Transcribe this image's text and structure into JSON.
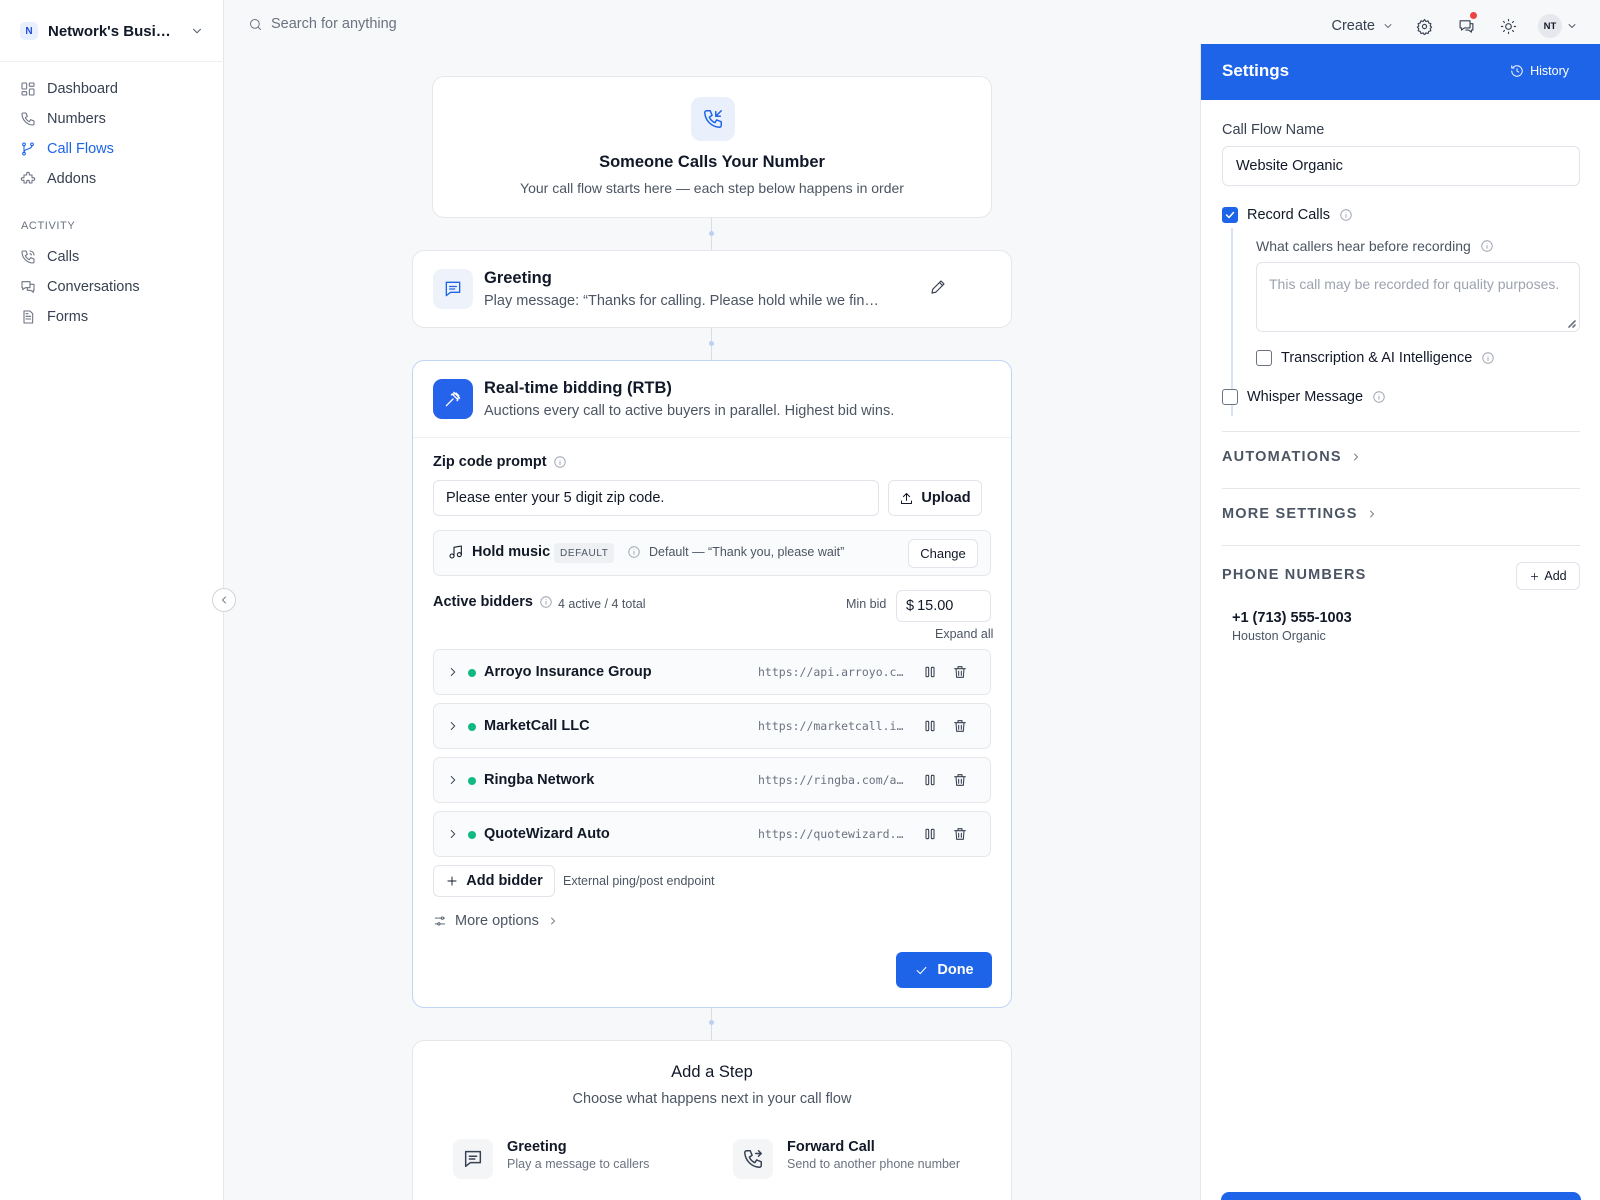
{
  "org": {
    "badge": "N",
    "name": "Network's Business"
  },
  "nav": {
    "items": [
      {
        "label": "Dashboard",
        "icon": "dashboard-icon"
      },
      {
        "label": "Numbers",
        "icon": "phone-icon"
      },
      {
        "label": "Call Flows",
        "icon": "call-flows-icon",
        "active": true
      },
      {
        "label": "Addons",
        "icon": "puzzle-icon"
      }
    ],
    "activity_heading": "ACTIVITY",
    "activity": [
      {
        "label": "Calls",
        "icon": "phone-calls-icon"
      },
      {
        "label": "Conversations",
        "icon": "chat-icon"
      },
      {
        "label": "Forms",
        "icon": "document-icon"
      }
    ]
  },
  "search": {
    "placeholder": "Search for anything"
  },
  "topbar": {
    "create_label": "Create",
    "avatar_initials": "NT",
    "has_notification": true
  },
  "flow": {
    "start": {
      "title": "Someone Calls Your Number",
      "subtitle": "Your call flow starts here — each step below happens in order"
    },
    "greeting": {
      "title": "Greeting",
      "subtitle": "Play message: “Thanks for calling. Please hold while we find the best agent for you.”"
    },
    "rtb": {
      "title": "Real-time bidding (RTB)",
      "subtitle": "Auctions every call to active buyers in parallel. Highest bid wins.",
      "zip_label": "Zip code prompt",
      "zip_value": "Please enter your 5 digit zip code.",
      "upload_label": "Upload",
      "hold_label": "Hold music",
      "hold_badge": "DEFAULT",
      "hold_desc": "Default — “Thank you, please wait”",
      "change_label": "Change",
      "bidders_label": "Active bidders",
      "bidders_count": "4 active / 4 total",
      "min_bid_label": "Min bid",
      "currency": "$",
      "min_bid_value": "15.00",
      "expand_all": "Expand all",
      "bidders": [
        {
          "name": "Arroyo Insurance Group",
          "url": "https://api.arroyo.com/rtb/ping",
          "status": "active"
        },
        {
          "name": "MarketCall LLC",
          "url": "https://marketcall.io/api/bid",
          "status": "active"
        },
        {
          "name": "Ringba Network",
          "url": "https://ringba.com/api/rtb",
          "status": "active"
        },
        {
          "name": "QuoteWizard Auto",
          "url": "https://quotewizard.com/rtb",
          "status": "active"
        }
      ],
      "add_bidder_label": "Add bidder",
      "add_bidder_hint": "External ping/post endpoint",
      "more_options_label": "More options",
      "done_label": "Done"
    },
    "add_step": {
      "title": "Add a Step",
      "subtitle": "Choose what happens next in your call flow",
      "options": [
        {
          "title": "Greeting",
          "desc": "Play a message to callers",
          "icon": "message-icon"
        },
        {
          "title": "Forward Call",
          "desc": "Send to another phone number",
          "icon": "phone-forward-icon"
        }
      ]
    }
  },
  "settings": {
    "title": "Settings",
    "history_label": "History",
    "name_label": "Call Flow Name",
    "name_value": "Website Organic",
    "record_calls_label": "Record Calls",
    "record_calls": true,
    "before_recording_label": "What callers hear before recording",
    "before_recording_placeholder": "This call may be recorded for quality purposes.",
    "transcription_label": "Transcription & AI Intelligence",
    "transcription": false,
    "whisper_label": "Whisper Message",
    "whisper": false,
    "automations_label": "AUTOMATIONS",
    "more_settings_label": "MORE SETTINGS",
    "phone_numbers_label": "PHONE NUMBERS",
    "add_label": "Add",
    "phone_numbers": [
      {
        "number": "+1 (713) 555-1003",
        "label": "Houston Organic"
      }
    ]
  },
  "colors": {
    "accent": "#1d64e8",
    "active_dot": "#10b981",
    "notify": "#ef4444"
  }
}
